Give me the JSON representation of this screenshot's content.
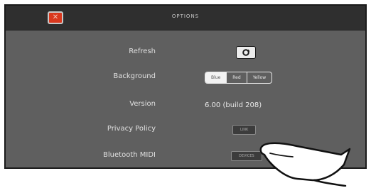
{
  "header": {
    "title": "OPTIONS",
    "close_icon": "close-icon"
  },
  "options": {
    "refresh": {
      "label": "Refresh",
      "icon": "refresh-icon"
    },
    "background": {
      "label": "Background",
      "options": [
        "Blue",
        "Red",
        "Yellow"
      ],
      "selected": "Blue"
    },
    "version": {
      "label": "Version",
      "value": "6.00 (build 208)"
    },
    "privacy": {
      "label": "Privacy Policy",
      "button": "LINK"
    },
    "bluetooth": {
      "label": "Bluetooth MIDI",
      "button": "DEVICES"
    }
  },
  "colors": {
    "panel": "#5f5f5f",
    "topbar": "#2f2f2f",
    "close_button": "#d9381e"
  }
}
